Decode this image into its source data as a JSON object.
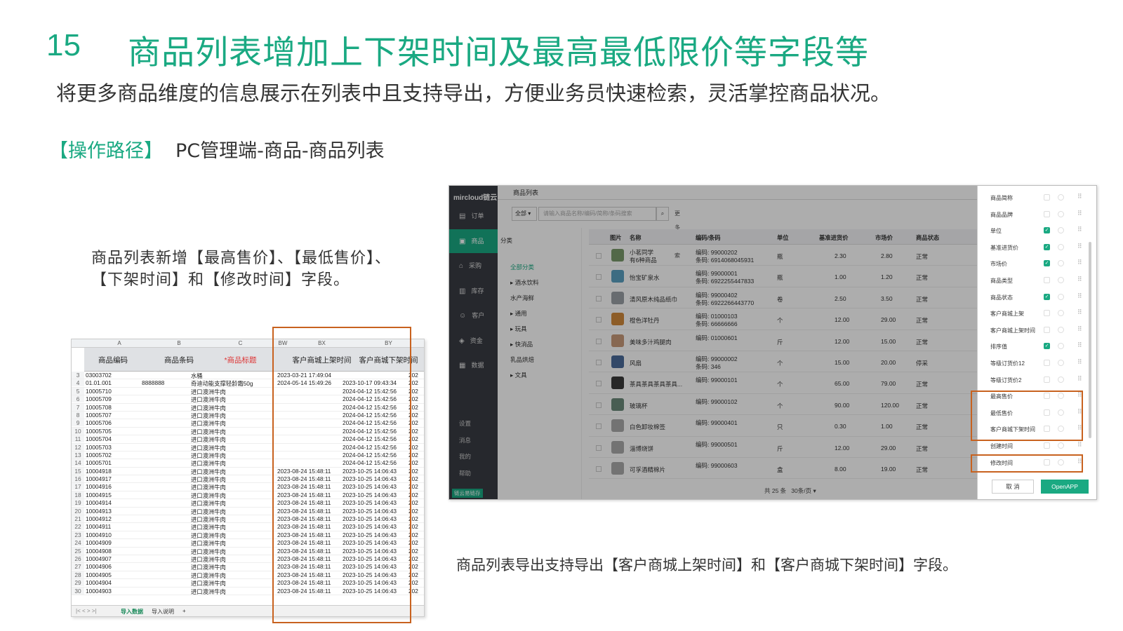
{
  "header": {
    "number": "15",
    "title": "商品列表增加上下架时间及最高最低限价等字段等",
    "subtitle": "将更多商品维度的信息展示在列表中且支持导出，方便业务员快速检索，灵活掌控商品状况。",
    "path_label": "【操作路径】",
    "path_value": "PC管理端-商品-商品列表"
  },
  "notes": {
    "left": "商品列表新增【最高售价】、【最低售价】、【下架时间】和【修改时间】字段。",
    "right": "商品列表导出支持导出【客户商城上架时间】和【客户商城下架时间】字段。"
  },
  "spreadsheet": {
    "col_letters": [
      "A",
      "B",
      "C",
      "BW",
      "BX",
      "BY"
    ],
    "headers": [
      "商品编码",
      "商品条码",
      "*商品标题",
      "客户商城上架时间",
      "客户商城下架时间"
    ],
    "rows": [
      {
        "n": "3",
        "a": "03003702",
        "b": "",
        "c": "水桶",
        "bx": "2023-03-21 17:49:04",
        "by": "",
        "z": "202"
      },
      {
        "n": "4",
        "a": "01.01.001",
        "b": "8888888",
        "c": "奇迪动能支撑轻龄霜50g",
        "bx": "2024-05-14 15:49:26",
        "by": "2023-10-17 09:43:34",
        "z": "202"
      },
      {
        "n": "5",
        "a": "10005710",
        "b": "",
        "c": "进口澳洲牛肉",
        "bx": "",
        "by": "2024-04-12 15:42:56",
        "z": "202"
      },
      {
        "n": "6",
        "a": "10005709",
        "b": "",
        "c": "进口澳洲牛肉",
        "bx": "",
        "by": "2024-04-12 15:42:56",
        "z": "202"
      },
      {
        "n": "7",
        "a": "10005708",
        "b": "",
        "c": "进口澳洲牛肉",
        "bx": "",
        "by": "2024-04-12 15:42:56",
        "z": "202"
      },
      {
        "n": "8",
        "a": "10005707",
        "b": "",
        "c": "进口澳洲牛肉",
        "bx": "",
        "by": "2024-04-12 15:42:56",
        "z": "202"
      },
      {
        "n": "9",
        "a": "10005706",
        "b": "",
        "c": "进口澳洲牛肉",
        "bx": "",
        "by": "2024-04-12 15:42:56",
        "z": "202"
      },
      {
        "n": "10",
        "a": "10005705",
        "b": "",
        "c": "进口澳洲牛肉",
        "bx": "",
        "by": "2024-04-12 15:42:56",
        "z": "202"
      },
      {
        "n": "11",
        "a": "10005704",
        "b": "",
        "c": "进口澳洲牛肉",
        "bx": "",
        "by": "2024-04-12 15:42:56",
        "z": "202"
      },
      {
        "n": "12",
        "a": "10005703",
        "b": "",
        "c": "进口澳洲牛肉",
        "bx": "",
        "by": "2024-04-12 15:42:56",
        "z": "202"
      },
      {
        "n": "13",
        "a": "10005702",
        "b": "",
        "c": "进口澳洲牛肉",
        "bx": "",
        "by": "2024-04-12 15:42:56",
        "z": "202"
      },
      {
        "n": "14",
        "a": "10005701",
        "b": "",
        "c": "进口澳洲牛肉",
        "bx": "",
        "by": "2024-04-12 15:42:56",
        "z": "202"
      },
      {
        "n": "15",
        "a": "10004918",
        "b": "",
        "c": "进口澳洲牛肉",
        "bx": "2023-08-24 15:48:11",
        "by": "2023-10-25 14:06:43",
        "z": "202"
      },
      {
        "n": "16",
        "a": "10004917",
        "b": "",
        "c": "进口澳洲牛肉",
        "bx": "2023-08-24 15:48:11",
        "by": "2023-10-25 14:06:43",
        "z": "202"
      },
      {
        "n": "17",
        "a": "10004916",
        "b": "",
        "c": "进口澳洲牛肉",
        "bx": "2023-08-24 15:48:11",
        "by": "2023-10-25 14:06:43",
        "z": "202"
      },
      {
        "n": "18",
        "a": "10004915",
        "b": "",
        "c": "进口澳洲牛肉",
        "bx": "2023-08-24 15:48:11",
        "by": "2023-10-25 14:06:43",
        "z": "202"
      },
      {
        "n": "19",
        "a": "10004914",
        "b": "",
        "c": "进口澳洲牛肉",
        "bx": "2023-08-24 15:48:11",
        "by": "2023-10-25 14:06:43",
        "z": "202"
      },
      {
        "n": "20",
        "a": "10004913",
        "b": "",
        "c": "进口澳洲牛肉",
        "bx": "2023-08-24 15:48:11",
        "by": "2023-10-25 14:06:43",
        "z": "202"
      },
      {
        "n": "21",
        "a": "10004912",
        "b": "",
        "c": "进口澳洲牛肉",
        "bx": "2023-08-24 15:48:11",
        "by": "2023-10-25 14:06:43",
        "z": "202"
      },
      {
        "n": "22",
        "a": "10004911",
        "b": "",
        "c": "进口澳洲牛肉",
        "bx": "2023-08-24 15:48:11",
        "by": "2023-10-25 14:06:43",
        "z": "202"
      },
      {
        "n": "23",
        "a": "10004910",
        "b": "",
        "c": "进口澳洲牛肉",
        "bx": "2023-08-24 15:48:11",
        "by": "2023-10-25 14:06:43",
        "z": "202"
      },
      {
        "n": "24",
        "a": "10004909",
        "b": "",
        "c": "进口澳洲牛肉",
        "bx": "2023-08-24 15:48:11",
        "by": "2023-10-25 14:06:43",
        "z": "202"
      },
      {
        "n": "25",
        "a": "10004908",
        "b": "",
        "c": "进口澳洲牛肉",
        "bx": "2023-08-24 15:48:11",
        "by": "2023-10-25 14:06:43",
        "z": "202"
      },
      {
        "n": "26",
        "a": "10004907",
        "b": "",
        "c": "进口澳洲牛肉",
        "bx": "2023-08-24 15:48:11",
        "by": "2023-10-25 14:06:43",
        "z": "202"
      },
      {
        "n": "27",
        "a": "10004906",
        "b": "",
        "c": "进口澳洲牛肉",
        "bx": "2023-08-24 15:48:11",
        "by": "2023-10-25 14:06:43",
        "z": "202"
      },
      {
        "n": "28",
        "a": "10004905",
        "b": "",
        "c": "进口澳洲牛肉",
        "bx": "2023-08-24 15:48:11",
        "by": "2023-10-25 14:06:43",
        "z": "202"
      },
      {
        "n": "29",
        "a": "10004904",
        "b": "",
        "c": "进口澳洲牛肉",
        "bx": "2023-08-24 15:48:11",
        "by": "2023-10-25 14:06:43",
        "z": "202"
      },
      {
        "n": "30",
        "a": "10004903",
        "b": "",
        "c": "进口澳洲牛肉",
        "bx": "2023-08-24 15:48:11",
        "by": "2023-10-25 14:06:43",
        "z": "202"
      }
    ],
    "tabs": {
      "nav": "|< < > >|",
      "active": "导入数据",
      "other": "导入说明",
      "add": "+"
    }
  },
  "app": {
    "logo": "mircloud链云",
    "page_title": "商品列表",
    "nav": [
      {
        "icon": "▤",
        "label": "订单"
      },
      {
        "icon": "▣",
        "label": "商品"
      },
      {
        "icon": "⌂",
        "label": "采购"
      },
      {
        "icon": "▥",
        "label": "库存"
      },
      {
        "icon": "☺",
        "label": "客户"
      },
      {
        "icon": "◈",
        "label": "资金"
      },
      {
        "icon": "▦",
        "label": "数据"
      }
    ],
    "subnav": [
      "设置",
      "消息",
      "我的",
      "帮助"
    ],
    "footer_brand": "链云易链存",
    "search": {
      "scope": "全部",
      "placeholder": "请输入商品名称/编码/简称/条码搜索",
      "more": "更多搜索"
    },
    "categories": {
      "title": "分类",
      "items": [
        "全部分类",
        "▸ 酒水饮料",
        "水产海鲜",
        "▸ 通用",
        "▸ 玩具",
        "▸ 快消品",
        "乳品烘焙",
        "▸ 文具"
      ]
    },
    "columns": [
      "图片",
      "名称",
      "编码/条码",
      "单位",
      "基准进货价",
      "市场价",
      "商品状态"
    ],
    "rows": [
      {
        "name": "小茗同学",
        "name2": "有6种商品",
        "code": "编码: 99000202",
        "bar": "条码: 6914068045931",
        "unit": "瓶",
        "cost": "2.30",
        "price": "2.80",
        "status": "正常",
        "img": "#7a9a6a"
      },
      {
        "name": "怡宝矿泉水",
        "name2": "",
        "code": "编码: 99000001",
        "bar": "条码: 6922255447833",
        "unit": "瓶",
        "cost": "1.00",
        "price": "1.20",
        "status": "正常",
        "img": "#5a9fc0"
      },
      {
        "name": "清风原木纯品纸巾",
        "name2": "",
        "code": "编码: 99000402",
        "bar": "条码: 6922266443770",
        "unit": "卷",
        "cost": "2.50",
        "price": "3.50",
        "status": "正常",
        "img": "#9aa0a6"
      },
      {
        "name": "橙色洋牡丹",
        "name2": "",
        "code": "编码: 01000103",
        "bar": "条码: 66666666",
        "unit": "个",
        "cost": "12.00",
        "price": "29.00",
        "status": "正常",
        "img": "#d08a3c"
      },
      {
        "name": "美味多汁鸡腿肉",
        "name2": "",
        "code": "编码: 01000601",
        "bar": "",
        "unit": "斤",
        "cost": "12.00",
        "price": "15.00",
        "status": "正常",
        "img": "#c89a7a"
      },
      {
        "name": "风扇",
        "name2": "",
        "code": "编码: 99000002",
        "bar": "条码: 346",
        "unit": "个",
        "cost": "15.00",
        "price": "20.00",
        "status": "停采",
        "img": "#4a6a9a"
      },
      {
        "name": "茶具茶具茶具茶具...",
        "name2": "",
        "code": "编码: 99000101",
        "bar": "",
        "unit": "个",
        "cost": "65.00",
        "price": "79.00",
        "status": "正常",
        "img": "#3a3a3a"
      },
      {
        "name": "玻璃杯",
        "name2": "",
        "code": "编码: 99000102",
        "bar": "",
        "unit": "个",
        "cost": "90.00",
        "price": "120.00",
        "status": "正常",
        "img": "#6a8a7a"
      },
      {
        "name": "白色卸妆棉签",
        "name2": "",
        "code": "编码: 99000401",
        "bar": "",
        "unit": "只",
        "cost": "0.30",
        "price": "1.00",
        "status": "正常",
        "img": "#aaaaaa"
      },
      {
        "name": "淄博烧饼",
        "name2": "",
        "code": "编码: 99000501",
        "bar": "",
        "unit": "斤",
        "cost": "12.00",
        "price": "29.00",
        "status": "正常",
        "img": "#aaaaaa"
      },
      {
        "name": "可孚酒精棉片",
        "name2": "",
        "code": "编码: 99000603",
        "bar": "",
        "unit": "盒",
        "cost": "8.00",
        "price": "19.00",
        "status": "正常",
        "img": "#aaaaaa"
      }
    ],
    "pager": {
      "total": "共 25 条",
      "size": "30条/页"
    },
    "panel": {
      "items": [
        {
          "label": "商品简称",
          "checked": false
        },
        {
          "label": "商品品牌",
          "checked": false
        },
        {
          "label": "单位",
          "checked": true
        },
        {
          "label": "基准进货价",
          "checked": true
        },
        {
          "label": "市场价",
          "checked": true
        },
        {
          "label": "商品类型",
          "checked": false
        },
        {
          "label": "商品状态",
          "checked": true
        },
        {
          "label": "客户商城上架",
          "checked": false
        },
        {
          "label": "客户商城上架时间",
          "checked": false
        },
        {
          "label": "排序值",
          "checked": true
        },
        {
          "label": "等级订货价12",
          "checked": false
        },
        {
          "label": "等级订货价2",
          "checked": false
        },
        {
          "label": "最高售价",
          "checked": false
        },
        {
          "label": "最低售价",
          "checked": false
        },
        {
          "label": "客户商城下架时间",
          "checked": false
        },
        {
          "label": "创建时间",
          "checked": false
        },
        {
          "label": "修改时间",
          "checked": false
        }
      ],
      "cancel": "取 消",
      "ok": "OpenAPP",
      "checkmark": "✓",
      "drag": "⠿"
    }
  },
  "colors": {
    "accent": "#1aa982",
    "highlight": "#c8621f",
    "sidebar": "#383c43"
  }
}
